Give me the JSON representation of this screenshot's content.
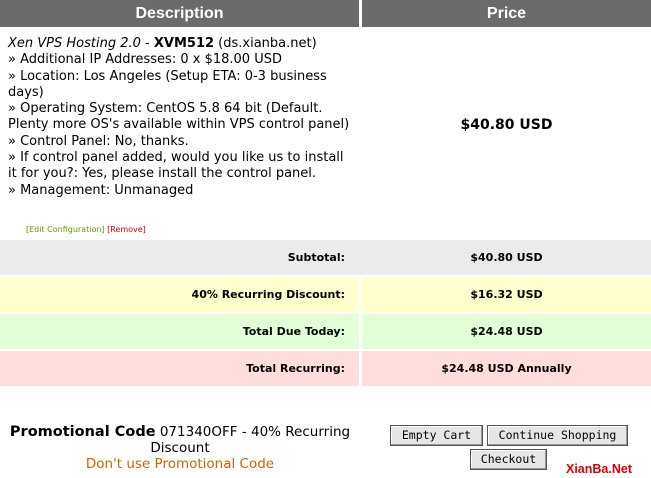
{
  "table": {
    "headers": {
      "description": "Description",
      "price": "Price"
    },
    "item": {
      "product_group": "Xen VPS Hosting 2.0",
      "product_sep": " - ",
      "product_name": "XVM512",
      "domain": " (ds.xianba.net)",
      "options": [
        "» Additional IP Addresses: 0 x $18.00 USD",
        "» Location: Los Angeles (Setup ETA: 0-3 business days)",
        "» Operating System: CentOS 5.8 64 bit (Default. Plenty more OS's available within VPS control panel)",
        "» Control Panel: No, thanks.",
        "» If control panel added, would you like us to install it for you?: Yes, please install the control panel.",
        "» Management: Unmanaged"
      ],
      "price": "$40.80 USD",
      "edit_label": "[Edit Configuration]",
      "remove_label": "[Remove]"
    },
    "summary": {
      "subtotal_label": "Subtotal:",
      "subtotal_value": "$40.80 USD",
      "discount_label": "40% Recurring Discount:",
      "discount_value": "$16.32 USD",
      "today_label": "Total Due Today:",
      "today_value": "$24.48 USD",
      "recurring_label": "Total Recurring:",
      "recurring_value": "$24.48 USD Annually"
    }
  },
  "promo": {
    "label": "Promotional Code",
    "text": " 071340OFF - 40% Recurring Discount",
    "remove_link": "Don't use Promotional Code"
  },
  "buttons": {
    "empty_cart": "Empty Cart",
    "continue_shopping": "Continue Shopping",
    "checkout": "Checkout"
  },
  "watermark": "XianBa.Net",
  "colors": {
    "header_bg": "#6b6b6b",
    "subtotal_bg": "#ebebeb",
    "discount_bg": "#ffffcc",
    "today_bg": "#e2ffd8",
    "recurring_bg": "#ffdddd",
    "promo_link": "#cc6600",
    "watermark": "#dd0000"
  }
}
